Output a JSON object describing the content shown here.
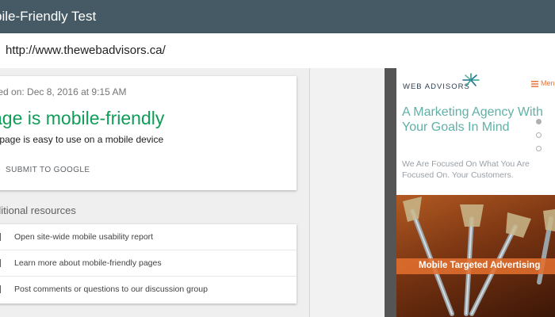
{
  "header": {
    "title": "bile-Friendly Test"
  },
  "url_bar": {
    "value": "http://www.thewebadvisors.ca/"
  },
  "result": {
    "tested_on": "sted on: Dec 8, 2016 at 9:15 AM",
    "verdict": "age is mobile-friendly",
    "verdict_sub": "s page is easy to use on a mobile device",
    "submit_label": "SUBMIT TO GOOGLE",
    "verdict_color": "#0f9d58"
  },
  "additional_resources": {
    "title": "ditional resources",
    "items": [
      {
        "label": "Open site-wide mobile usability report"
      },
      {
        "label": "Learn more about mobile-friendly pages"
      },
      {
        "label": "Post comments or questions to our discussion group"
      }
    ]
  },
  "preview": {
    "logo": "WEB ADVISORS",
    "menu_label": "Men",
    "hero_title": "A Marketing Agency With Your Goals In Mind",
    "hero_sub": "We Are Focused On What You Are Focused On. Your Customers.",
    "banner_caption": "Mobile Targeted Advertising",
    "accent_color": "#e8743b",
    "teal_color": "#5fb1a8"
  }
}
